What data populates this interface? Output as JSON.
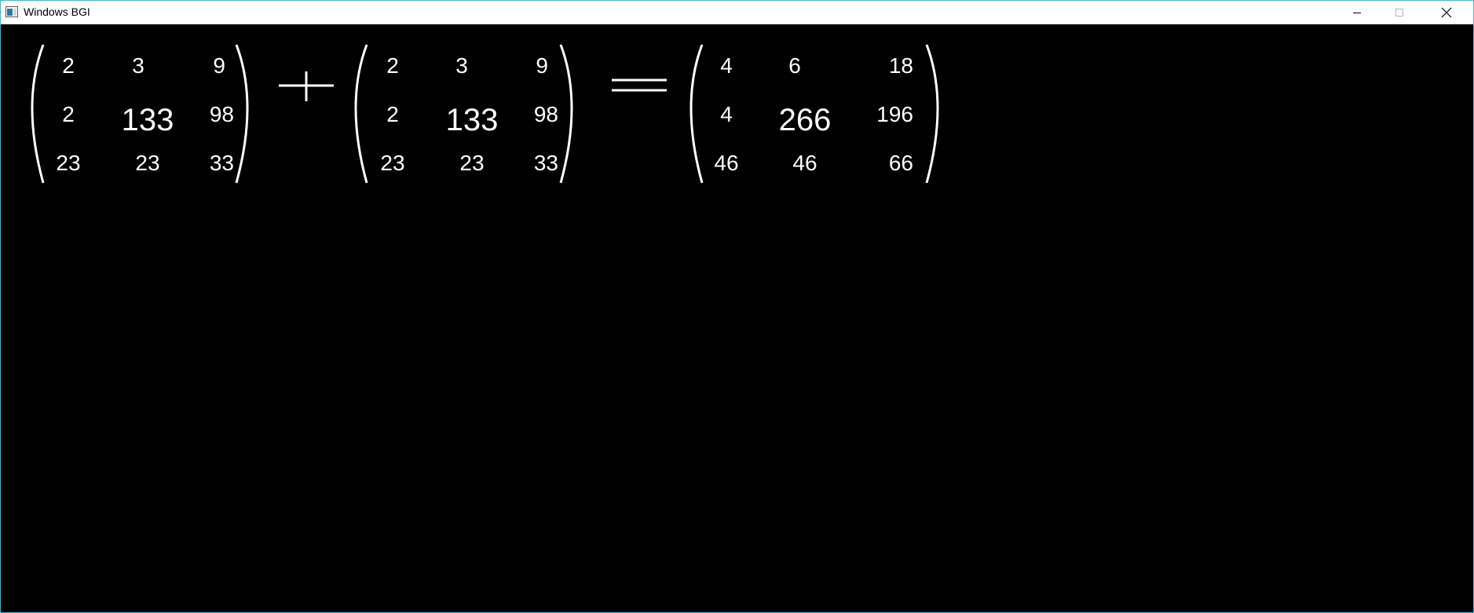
{
  "window": {
    "title": "Windows BGI",
    "controls": {
      "minimize_icon": "minimize-icon",
      "maximize_icon": "maximize-icon",
      "close_icon": "close-icon"
    },
    "border_color": "#3fb6c8"
  },
  "canvas": {
    "background": "#000000",
    "text_color": "#ffffff",
    "operators": {
      "plus": "+",
      "equals": "="
    },
    "matrices": [
      {
        "name": "matrix-a",
        "rows": [
          [
            "2",
            "3",
            "9"
          ],
          [
            "2",
            "133",
            "98"
          ],
          [
            "23",
            "23",
            "33"
          ]
        ],
        "highlight_color": "#7070e8"
      },
      {
        "name": "matrix-b",
        "rows": [
          [
            "2",
            "3",
            "9"
          ],
          [
            "2",
            "133",
            "98"
          ],
          [
            "23",
            "23",
            "33"
          ]
        ],
        "highlight_color": "#f4f000"
      },
      {
        "name": "matrix-result",
        "rows": [
          [
            "4",
            "6",
            "18"
          ],
          [
            "4",
            "266",
            "196"
          ],
          [
            "46",
            "46",
            "66"
          ]
        ],
        "highlight_color": "#80e880"
      }
    ]
  }
}
